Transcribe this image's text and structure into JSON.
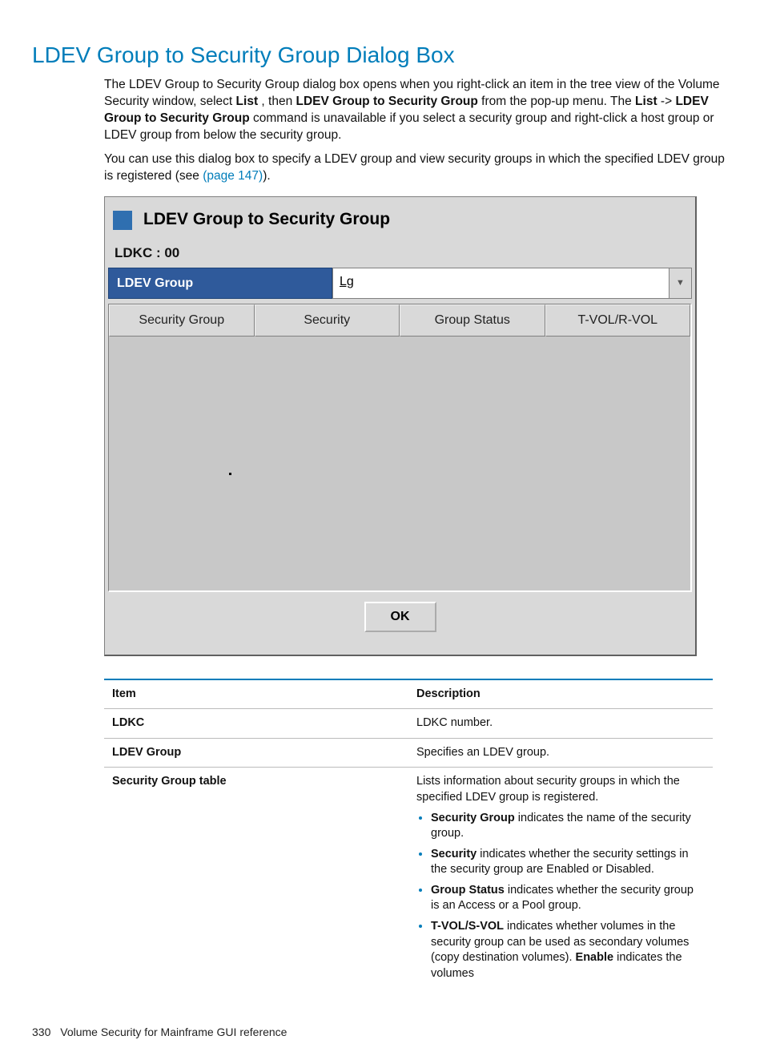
{
  "heading": "LDEV Group to Security Group Dialog Box",
  "intro": {
    "p1_a": "The LDEV Group to Security Group dialog box opens when you right-click an item in the tree view of the Volume Security window, select ",
    "list_bold1": "List",
    "p1_b": " , then ",
    "ldev_to_sec_bold": "LDEV Group to Security Group",
    "p1_c": " from the pop-up menu. The ",
    "list_bold2": "List",
    "arrow": "  -> ",
    "ldev_to_sec_bold2": "LDEV Group to Security Group",
    "p1_d": " command is unavailable if you select a security group and right-click a host group or LDEV group from below the security group.",
    "p2_a": "You can use this dialog box to specify a LDEV group and view security groups in which the specified LDEV group is registered (see ",
    "page_ref": "(page 147)",
    "p2_b": ")."
  },
  "dialog": {
    "title": "LDEV Group to Security Group",
    "ldkc_label": "LDKC : 00",
    "ldev_group_label": "LDEV Group",
    "ldev_group_value": "Lg",
    "grid_headers": [
      "Security Group",
      "Security",
      "Group Status",
      "T-VOL/R-VOL"
    ],
    "ok": "OK"
  },
  "table": {
    "head_item": "Item",
    "head_desc": "Description",
    "rows": {
      "ldkc": {
        "item": "LDKC",
        "desc": "LDKC number."
      },
      "ldev_group": {
        "item": "LDEV Group",
        "desc": "Specifies an LDEV group."
      },
      "sec_table": {
        "item": "Security Group table",
        "lead": "Lists information about security groups in which the specified LDEV group is registered.",
        "b1_bold": "Security Group",
        "b1_rest": " indicates the name of the security group.",
        "b2_bold": "Security",
        "b2_rest": " indicates whether the security settings in the security group are Enabled or Disabled.",
        "b3_bold": "Group Status",
        "b3_rest": " indicates whether the security group is an Access or a Pool group.",
        "b4_bold": "T-VOL/S-VOL",
        "b4_rest_a": " indicates whether volumes in the security group can be used as secondary volumes (copy destination volumes). ",
        "b4_enable_bold": "Enable",
        "b4_rest_b": " indicates the volumes"
      }
    }
  },
  "footer": {
    "page_num": "330",
    "text": "Volume Security for Mainframe GUI reference"
  }
}
